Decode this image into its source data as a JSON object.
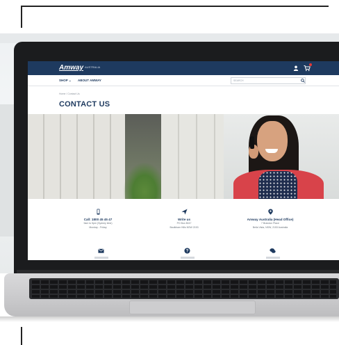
{
  "site": {
    "logo_text": "Amway",
    "region": "AUSTRALIA",
    "nav_shop": "SHOP ⌄",
    "nav_about": "ABOUT AMWAY",
    "search_placeholder": "SEARCH",
    "breadcrumb": "Home / Contact Us",
    "page_title": "CONTACT US",
    "brand_color": "#1e3a5f"
  },
  "contacts": [
    {
      "icon": "mobile-phone-icon",
      "title": "Call: 1800 45 45 47",
      "line1": "9am to 5pm (Sydney time)",
      "line2": "Monday - Friday"
    },
    {
      "icon": "paper-plane-icon",
      "title": "Write us",
      "line1": "PO Box 8047",
      "line2": "Baulkham Hills NSW 2153"
    },
    {
      "icon": "map-pin-icon",
      "title": "Amway Australia (Head Office)",
      "line1": "7 Brandon Place",
      "line2": "Bella Vista, NSW, 2153 Australia"
    }
  ],
  "second_row_icons": [
    "envelope-icon",
    "question-icon",
    "chat-bubbles-icon"
  ]
}
